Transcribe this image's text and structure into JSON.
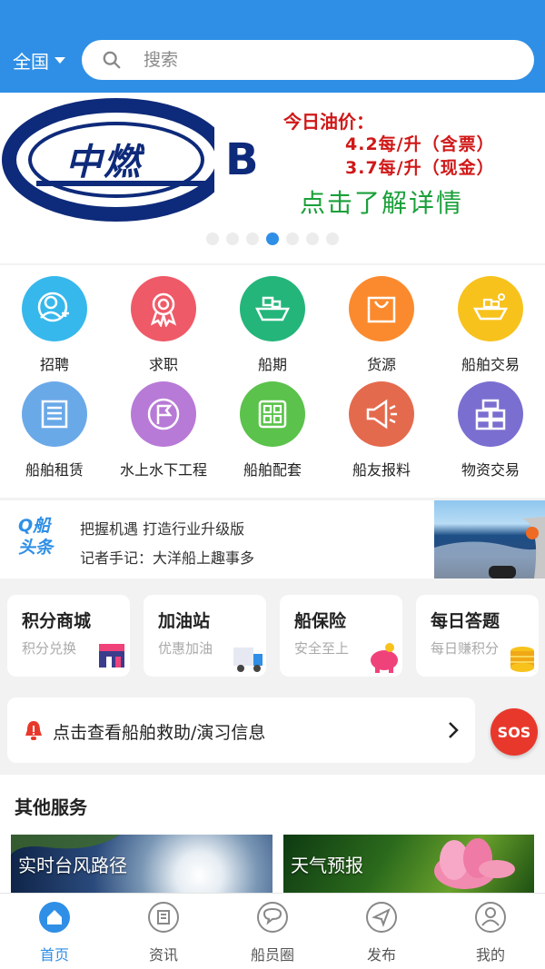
{
  "header": {
    "region": "全国",
    "search_placeholder": "搜索"
  },
  "banner": {
    "logo_text": "中燃",
    "logo_letter": "B",
    "oil_title": "今日油价：",
    "price_with_invoice": "4.2每/升（含票）",
    "price_cash": "3.7每/升（现金）",
    "cta": "点击了解详情",
    "dots_total": 7,
    "dots_active_index": 3
  },
  "categories": [
    {
      "label": "招聘",
      "icon": "user-add-icon",
      "color": "#36b8ec"
    },
    {
      "label": "求职",
      "icon": "award-ribbon-icon",
      "color": "#ef5a68"
    },
    {
      "label": "船期",
      "icon": "ship-icon",
      "color": "#23b57a"
    },
    {
      "label": "货源",
      "icon": "shopping-bag-icon",
      "color": "#fb8a2e"
    },
    {
      "label": "船舶交易",
      "icon": "cargo-ship-icon",
      "color": "#f8c21d"
    },
    {
      "label": "船舶租赁",
      "icon": "document-list-icon",
      "color": "#6aa9e8"
    },
    {
      "label": "水上水下工程",
      "icon": "flag-icon",
      "color": "#b87ad7"
    },
    {
      "label": "船舶配套",
      "icon": "grid-icon",
      "color": "#5bc24b"
    },
    {
      "label": "船友报料",
      "icon": "megaphone-icon",
      "color": "#e46a4e"
    },
    {
      "label": "物资交易",
      "icon": "boxes-icon",
      "color": "#7a6fd0"
    }
  ],
  "news": {
    "brand_line1": "Q船",
    "brand_line2": "头条",
    "headline1": "把握机遇 打造行业升级版",
    "headline2": "记者手记：大洋船上趣事多"
  },
  "services": [
    {
      "title": "积分商城",
      "subtitle": "积分兑换",
      "icon": "shop-icon"
    },
    {
      "title": "加油站",
      "subtitle": "优惠加油",
      "icon": "truck-icon"
    },
    {
      "title": "船保险",
      "subtitle": "安全至上",
      "icon": "piggy-bank-icon"
    },
    {
      "title": "每日答题",
      "subtitle": "每日赚积分",
      "icon": "coins-icon"
    }
  ],
  "rescue": {
    "text": "点击查看船舶救助/演习信息",
    "sos": "SOS"
  },
  "other_services": {
    "title": "其他服务",
    "tiles": [
      {
        "label": "实时台风路径"
      },
      {
        "label": "天气预报"
      }
    ]
  },
  "nav": [
    {
      "label": "首页",
      "icon": "home-icon",
      "active": true
    },
    {
      "label": "资讯",
      "icon": "news-icon",
      "active": false
    },
    {
      "label": "船员圈",
      "icon": "chat-bubble-icon",
      "active": false
    },
    {
      "label": "发布",
      "icon": "send-icon",
      "active": false
    },
    {
      "label": "我的",
      "icon": "profile-icon",
      "active": false
    }
  ],
  "colors": {
    "primary": "#2f8fe6",
    "price_red": "#d01818",
    "cta_green": "#1aa03a",
    "sos_red": "#e8382c"
  }
}
